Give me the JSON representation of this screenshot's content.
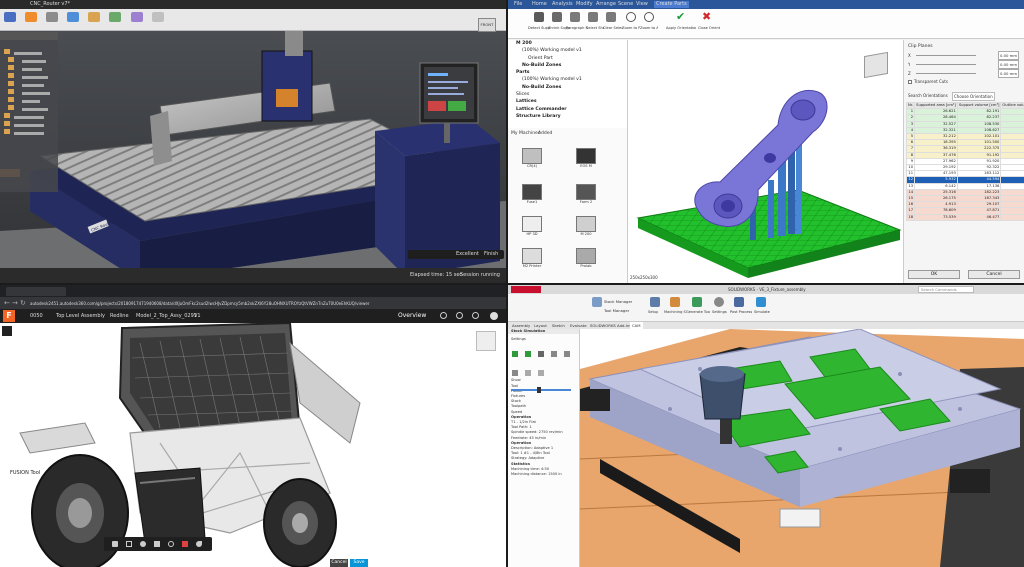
{
  "q1": {
    "title": "CNC_Router v7*",
    "viewcube": "FRONT",
    "timeline_label": "Elapsed time: 15 sec",
    "timeline_status": "Session running",
    "excellent_label": "Excellent",
    "finish_label": "Finish",
    "machine_badge": "CNC Router"
  },
  "q2": {
    "tabs": [
      "File",
      "Home",
      "Analysis",
      "Modify",
      "Arrange",
      "Scene",
      "View",
      "Create Parts"
    ],
    "ribbon_buttons": [
      "Detect Supports",
      "Shrink Supports",
      "Paragraph Selection",
      "Select Shell",
      "Clear Selection",
      "Zoom to Part",
      "Zoom to Area",
      "Apply Orientation to Part",
      "Close Orient Part"
    ],
    "tree_rows": [
      "M 200",
      "(100%) Working model v1",
      "Orient Part",
      "No-Build Zones",
      "Parts",
      "(100%) Working model v1",
      "No-Build Zones",
      "Slices",
      "Lattices",
      "Lattice Commander",
      "Structure Library"
    ],
    "machines_title": "My Machines",
    "machines_tab": "Added",
    "machines": [
      "CR(4)",
      "EOS M",
      "Fuse1",
      "Form 2",
      "HP 3D",
      "M 200",
      "M2 Printer",
      "Prolab"
    ],
    "clip_title": "Clip Planes",
    "clip_values": [
      "X",
      "Y",
      "Z"
    ],
    "clip_mm": [
      "0.00 mm",
      "0.00 mm",
      "0.00 mm"
    ],
    "transparent_cuts": "Transparent Cuts",
    "panel_tab1": "Search Orientations",
    "panel_tab2": "Choose Orientation",
    "table_headers": [
      "Nr.",
      "Supported area [cm²]",
      "Support volume [cm³]",
      "Outline volume [cm³]",
      "Height [mm]",
      "Center of gravity [mm]"
    ],
    "table_rows": [
      [
        "1",
        "26.621",
        "82.191",
        "18.1",
        "47.1",
        "20.6"
      ],
      [
        "2",
        "28.464",
        "82.237",
        "386.7",
        "63.5",
        "22.6"
      ],
      [
        "3",
        "32.527",
        "108.530",
        "9.0",
        "52.7",
        "22.8"
      ],
      [
        "4",
        "32.321",
        "108.627",
        "46.0",
        "17.2",
        "36.8"
      ],
      [
        "5",
        "32.212",
        "102.101",
        "86.0",
        "21.0",
        "19.9"
      ],
      [
        "6",
        "18.395",
        "101.500",
        "8.5",
        "355.7",
        "287.2"
      ],
      [
        "7",
        "36.319",
        "222.375",
        "1800.1",
        "57.7",
        "104.5"
      ],
      [
        "8",
        "37.476",
        "91.192",
        "1643.0",
        "64.1",
        "39.6"
      ],
      [
        "9",
        "27.962",
        "91.920",
        "1722.1",
        "19.2",
        "59.1"
      ],
      [
        "10",
        "29.192",
        "92.322",
        "1681.7",
        "49.7",
        "39.9"
      ],
      [
        "11",
        "47.193",
        "163.112",
        "1981.6",
        "58.1",
        "12.2"
      ],
      [
        "12",
        "5.932",
        "44.594",
        "984.3",
        "364.3",
        "146.8"
      ],
      [
        "13",
        "6.142",
        "17.136",
        "1010.3",
        "70.1",
        "15.0"
      ],
      [
        "14",
        "25.316",
        "182.223",
        "2658.1",
        "707.1",
        "16.3"
      ],
      [
        "15",
        "26.175",
        "187.343",
        "2821.6",
        "103.1",
        "16.6"
      ],
      [
        "16",
        "4.913",
        "29.107",
        "4491.5",
        "200.1",
        "12.4"
      ],
      [
        "17",
        "78.609",
        "47.871",
        "3211.3",
        "71.3",
        "16.2"
      ],
      [
        "18",
        "73.539",
        "46.477",
        "2861.2",
        "12.2",
        "18.2"
      ]
    ],
    "ok_label": "OK",
    "cancel_label": "Cancel",
    "status": "250x250x300"
  },
  "q3": {
    "url": "autodesk2451.autodesk360.com/g/projects/20180917471940608/data/dXJuOmFkc2sud2lwcHJvZDpmcy5mb2xkZXI6Y28uOHNXUTROYzQtVWZnTnZuT0U0eEhKUQ/viewer",
    "app_initial": "F",
    "breadcrumb": [
      "0050",
      "Top Level Assembly",
      "Redline",
      "Model_2_Top_Assy_0291"
    ],
    "version": "V1",
    "overview": "Overview",
    "tool_title": "FUSION Tool",
    "cancel_label": "Cancel",
    "save_label": "Save"
  },
  "q4": {
    "window_title": "SOLIDWORKS - VE_3_Fixture_assembly",
    "search_placeholder": "Search Commands",
    "commands": [
      "Stock Manager",
      "Tool Manager",
      "Setup",
      "Machining Setup",
      "Generate Toolpath",
      "Settings",
      "Post Process",
      "Simulate"
    ],
    "tabs": [
      "Assembly",
      "Layout",
      "Sketch",
      "Evaluate",
      "SOLIDWORKS Add-Ins",
      "CAM"
    ],
    "panel_title": "Stock Simulation",
    "panel_lines": [
      "Settings",
      "Show",
      "Tool",
      "Holder",
      "Fixtures",
      "Stock",
      "Toolpath",
      "Speed",
      "Operation",
      "T1 - 1/2in Flat",
      "Tool Path: 1",
      "Spindle speed: 2750 rev/min",
      "Feedrate: 45 in/min",
      "Operation",
      "Description: Adaptive 1",
      "Tool: 1 #1 - 4/8in Tool",
      "Strategy: Adaptive",
      "Statistics",
      "Machining time: 4:50",
      "Machining distance: 1500 in"
    ]
  },
  "colors": {
    "netfabb_blue": "#2b579a",
    "part_purple": "#7a76d8",
    "support_blue": "#3b78c8",
    "plate_green": "#22c02c",
    "cam_green": "#2fb52f",
    "wood_orange": "#e8a56c",
    "selected_row": "#1c5fb4"
  }
}
